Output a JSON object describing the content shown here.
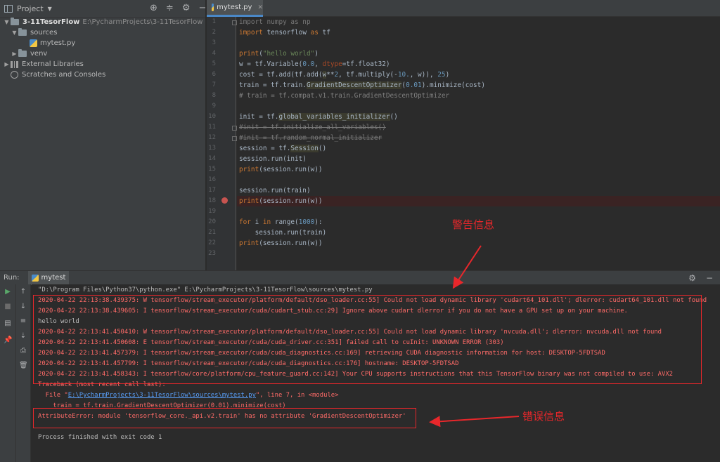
{
  "project_panel": {
    "title": "Project",
    "project_name": "3-11TesorFlow",
    "project_path": "E:\\PycharmProjects\\3-11TesorFlow",
    "tree": {
      "sources": "sources",
      "mytest": "mytest.py",
      "venv": "venv",
      "external_libraries": "External Libraries",
      "scratches": "Scratches and Consoles"
    }
  },
  "editor": {
    "tab_name": "mytest.py",
    "line_numbers": [
      "1",
      "2",
      "3",
      "4",
      "5",
      "6",
      "7",
      "8",
      "9",
      "10",
      "11",
      "12",
      "13",
      "14",
      "15",
      "16",
      "17",
      "18",
      "19",
      "20",
      "21",
      "22",
      "23"
    ],
    "breakpoint_line": 18
  },
  "run": {
    "label": "Run:",
    "tab_name": "mytest",
    "command": "\"D:\\Program Files\\Python37\\python.exe\" E:\\PycharmProjects\\3-11TesorFlow\\sources\\mytest.py",
    "output": [
      "2020-04-22 22:13:38.439375: W tensorflow/stream_executor/platform/default/dso_loader.cc:55] Could not load dynamic library 'cudart64_101.dll'; dlerror: cudart64_101.dll not found",
      "2020-04-22 22:13:38.439605: I tensorflow/stream_executor/cuda/cudart_stub.cc:29] Ignore above cudart dlerror if you do not have a GPU set up on your machine.",
      "hello world",
      "2020-04-22 22:13:41.450410: W tensorflow/stream_executor/platform/default/dso_loader.cc:55] Could not load dynamic library 'nvcuda.dll'; dlerror: nvcuda.dll not found",
      "2020-04-22 22:13:41.450608: E tensorflow/stream_executor/cuda/cuda_driver.cc:351] failed call to cuInit: UNKNOWN ERROR (303)",
      "2020-04-22 22:13:41.457379: I tensorflow/stream_executor/cuda/cuda_diagnostics.cc:169] retrieving CUDA diagnostic information for host: DESKTOP-5FDTSAD",
      "2020-04-22 22:13:41.457799: I tensorflow/stream_executor/cuda/cuda_diagnostics.cc:176] hostname: DESKTOP-5FDTSAD",
      "2020-04-22 22:13:41.458343: I tensorflow/core/platform/cpu_feature_guard.cc:142] Your CPU supports instructions that this TensorFlow binary was not compiled to use: AVX2"
    ],
    "traceback_header": "Traceback (most recent call last):",
    "traceback_file_prefix": "  File \"",
    "traceback_file_link": "E:\\PycharmProjects\\3-11TesorFlow\\sources\\mytest.py",
    "traceback_file_suffix": "\", line 7, in <module>",
    "traceback_code": "    train = tf.train.GradientDescentOptimizer(0.01).minimize(cost)",
    "error": "AttributeError: module 'tensorflow_core._api.v2.train' has no attribute 'GradientDescentOptimizer'",
    "exit": "Process finished with exit code 1"
  },
  "annotations": {
    "warning_label": "警告信息",
    "error_label": "错误信息",
    "color": "#e8272b"
  },
  "colors": {
    "keyword": "#cc7832",
    "string": "#6a8759",
    "number": "#6897bb",
    "error_text": "#ff6b68",
    "link": "#589df6"
  }
}
